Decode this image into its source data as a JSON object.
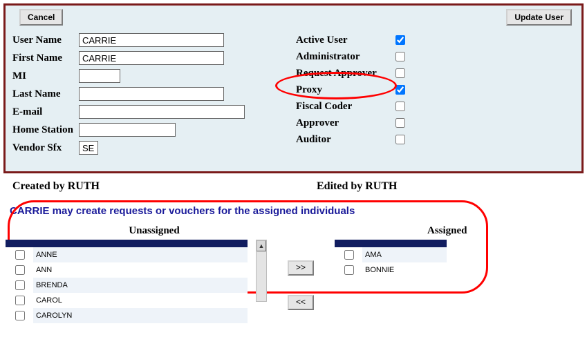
{
  "buttons": {
    "cancel": "Cancel",
    "update": "Update User",
    "add": ">>",
    "remove": "<<"
  },
  "user": {
    "labels": {
      "user_name": "User Name",
      "first_name": "First Name",
      "mi": "MI",
      "last_name": "Last Name",
      "email": "E-mail",
      "home_station": "Home Station",
      "vendor_sfx": "Vendor Sfx"
    },
    "values": {
      "user_name": "CARRIE",
      "first_name": "CARRIE",
      "mi": "",
      "last_name": "",
      "email": "",
      "home_station": "",
      "vendor_sfx": "SE"
    }
  },
  "roles": {
    "active_user": {
      "label": "Active User",
      "checked": true
    },
    "administrator": {
      "label": "Administrator",
      "checked": false
    },
    "request_approver": {
      "label": "Request Approver",
      "checked": false
    },
    "proxy": {
      "label": "Proxy",
      "checked": true
    },
    "fiscal_coder": {
      "label": "Fiscal Coder",
      "checked": false
    },
    "approver": {
      "label": "Approver",
      "checked": false
    },
    "auditor": {
      "label": "Auditor",
      "checked": false
    }
  },
  "audit": {
    "created_by_label": "Created by ",
    "created_by": "RUTH",
    "edited_by_label": "Edited by ",
    "edited_by": "RUTH"
  },
  "assign": {
    "heading": "CARRIE may create requests or vouchers for the assigned individuals",
    "unassigned_header": "Unassigned",
    "assigned_header": "Assigned",
    "unassigned": [
      "ANNE",
      "ANN",
      "BRENDA",
      "CAROL",
      "CAROLYN"
    ],
    "assigned": [
      "AMA",
      "BONNIE"
    ]
  }
}
